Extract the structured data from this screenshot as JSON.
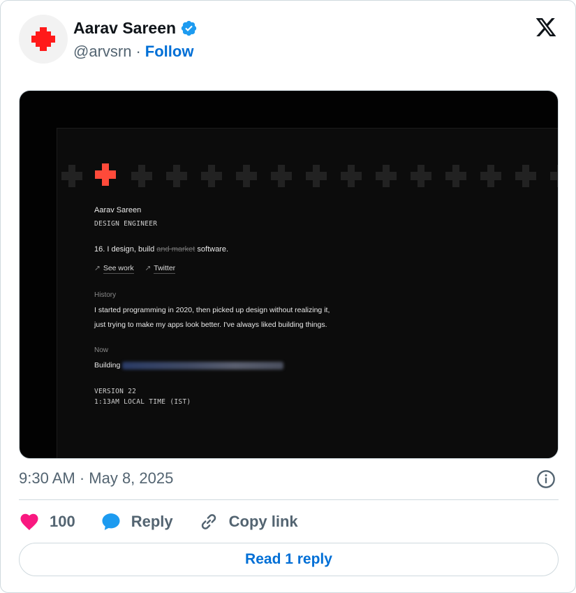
{
  "author": {
    "name": "Aarav Sareen",
    "handle": "@arvsrn",
    "separator": "·",
    "follow_label": "Follow"
  },
  "colors": {
    "accent_blue": "#006fd6",
    "like_pink": "#f91880",
    "reply_blue": "#1d9bf0",
    "brand_red": "#ff4a3a"
  },
  "icons": {
    "avatar": "red-plus-icon",
    "verified": "verified-badge-icon",
    "brand": "x-logo-icon",
    "info": "info-icon",
    "like": "heart-icon",
    "reply": "speech-bubble-icon",
    "copy": "link-icon"
  },
  "screenshot": {
    "name": "Aarav Sareen",
    "role": "DESIGN ENGINEER",
    "tagline_prefix": "16. I design, build",
    "tagline_strike": "and market",
    "tagline_suffix": "software.",
    "link_work": "See work",
    "link_twitter": "Twitter",
    "history_label": "History",
    "history_line1": "I started programming in 2020, then picked up design without realizing it,",
    "history_line2": "just trying to make my apps look better. I've always liked building things.",
    "now_label": "Now",
    "now_text": "Building",
    "version": "VERSION 22",
    "local_time": "1:13AM LOCAL TIME (IST)"
  },
  "meta": {
    "timestamp": "9:30 AM · May 8, 2025"
  },
  "actions": {
    "like_count": "100",
    "reply_label": "Reply",
    "copy_label": "Copy link"
  },
  "read_replies_label": "Read 1 reply"
}
